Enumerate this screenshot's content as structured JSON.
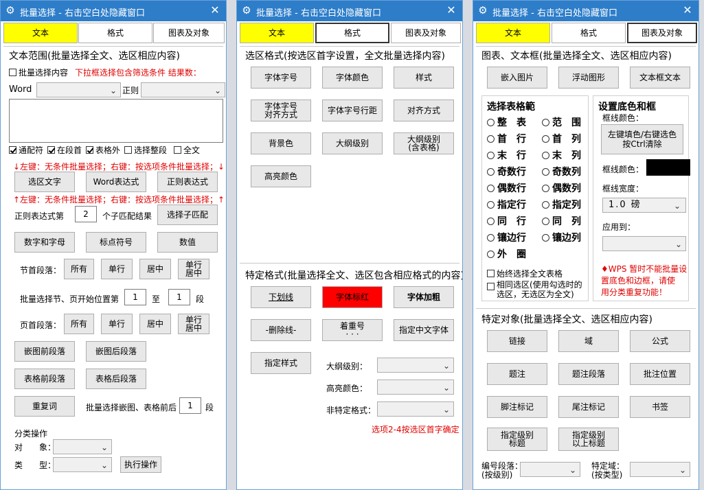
{
  "window_title": "批量选择 - 右击空白处隐藏窗口",
  "tabs": [
    "文本",
    "格式",
    "图表及对象"
  ],
  "colors": {
    "titlebar": "#2d7dc9",
    "tab_active": "#ffff00",
    "red_button": "#ff0000",
    "warning_text": "#e00000"
  },
  "icons": {
    "title": "gear-icon",
    "close": "close-icon"
  },
  "w1": {
    "scope_header": "文本范围(批量选择全文、选区相应内容)",
    "batch_select_content": "批量选择内容",
    "hint_dropdown": "下拉框选择包含筛选条件 结果数：",
    "word_label": "Word",
    "regex_label": "正则",
    "checkboxes": [
      {
        "label": "通配符",
        "checked": true
      },
      {
        "label": "在段首",
        "checked": true
      },
      {
        "label": "表格外",
        "checked": true
      },
      {
        "label": "选择整段",
        "checked": false
      },
      {
        "label": "全文",
        "checked": false
      }
    ],
    "hint_left_click_1": "↓左键：无条件批量选择；右键：按选项条件批量选择；↓",
    "btn_select_text": "选区文字",
    "btn_word_expr": "Word表达式",
    "btn_regex_expr": "正则表达式",
    "hint_left_click_2": "↑左键：无条件批量选择；右键：按选项条件批量选择；↑",
    "regex_nth_label": "正则表达式第",
    "regex_nth_value": "2",
    "regex_sub_label": "个子匹配结果",
    "btn_select_sub": "选择子匹配",
    "btn_num_letter": "数字和字母",
    "btn_punct": "标点符号",
    "btn_value": "数值",
    "section_para_label": "节首段落：",
    "btn_all": "所有",
    "btn_single": "单行",
    "btn_center": "居中",
    "btn_single_center_1": "单行",
    "btn_single_center_2": "居中",
    "batch_pos_label": "批量选择节、页开始位置第",
    "pos_from": "1",
    "pos_to_label": "至",
    "pos_to": "1",
    "pos_unit": "段",
    "page_para_label": "页首段落：",
    "btn_pre_embed": "嵌图前段落",
    "btn_post_embed": "嵌图后段落",
    "btn_pre_table": "表格前段落",
    "btn_post_table": "表格后段落",
    "btn_repeat": "重复词",
    "batch_embed_label": "批量选择嵌图、表格前后",
    "batch_embed_value": "1",
    "batch_embed_unit": "段",
    "classify_header": "分类操作",
    "object_label": "对　　象：",
    "type_label": "类　　型：",
    "btn_execute": "执行操作"
  },
  "w2": {
    "sel_format_header": "选区格式(按选区首字设置，全文批量选择内容)",
    "buttons": [
      "字体字号",
      "字体颜色",
      "样式",
      "字体字号|对齐方式",
      "字体字号行距",
      "对齐方式",
      "背景色",
      "大纲级别",
      "大纲级别|(含表格)",
      "高亮颜色"
    ],
    "special_header": "特定格式(批量选择全文、选区包含相应格式的内容)",
    "btn_underline": "下划线",
    "btn_red_font": "字体标红",
    "btn_bold": "字体加粗",
    "btn_strike": "-删除线-",
    "btn_emphasis": "着重号",
    "btn_emphasis_dots": "· · ·",
    "btn_cn_font": "指定中文字体",
    "btn_style": "指定样式",
    "outline_label": "大纲级别：",
    "highlight_label": "高亮颜色：",
    "nonspecific_label": "非特定格式：",
    "note": "选项2-4按选区首字确定"
  },
  "w3": {
    "chart_header": "图表、文本框(批量选择全文、选区相应内容)",
    "btn_embed_img": "嵌入图片",
    "btn_float_shape": "浮动图形",
    "btn_textbox": "文本框文本",
    "table_range_header": "选择表格範",
    "radios_left": [
      "整　表",
      "首　行",
      "末　行",
      "奇数行",
      "偶数行",
      "指定行",
      "同　行",
      "镶边行",
      "外　圈"
    ],
    "radios_right": [
      "范　围",
      "首　列",
      "末　列",
      "奇数列",
      "偶数列",
      "指定列",
      "同　列",
      "镶边列"
    ],
    "always_full_table": "始终选择全文表格",
    "same_selection_1": "相同选区(使用勾选时的",
    "same_selection_2": "选区，无选区为全文)",
    "border_header": "设置底色和框",
    "border_color_label": "框线颜色：",
    "btn_fill_1": "左键填色/右键选色",
    "btn_fill_2": "按Ctrl清除",
    "border_color_label2": "框线颜色：",
    "border_width_label": "框线宽度：",
    "border_width_value": "1.0 磅",
    "apply_to_label": "应用到：",
    "wps_warning_1": "♦WPS 暂时不能批量设",
    "wps_warning_2": "置底色和边框，请使",
    "wps_warning_3": "用分类重复功能！",
    "special_obj_header": "特定对象(批量选择全文、选区相应内容)",
    "btn_link": "链接",
    "btn_field": "域",
    "btn_formula": "公式",
    "btn_caption": "题注",
    "btn_caption_para": "题注段落",
    "btn_comment_pos": "批注位置",
    "btn_footnote": "脚注标记",
    "btn_endnote": "尾注标记",
    "btn_bookmark": "书签",
    "btn_level_title_1": "指定级别",
    "btn_level_title_2": "标题",
    "btn_level_above_1": "指定级别",
    "btn_level_above_2": "以上标题",
    "num_para_label_1": "编号段落：",
    "num_para_label_2": "(按级别)",
    "special_field_label_1": "特定域：",
    "special_field_label_2": "(按类型)"
  }
}
